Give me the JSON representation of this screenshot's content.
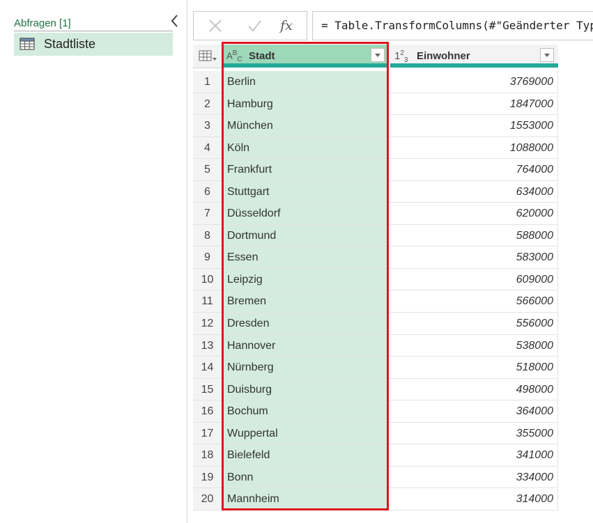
{
  "queries_pane": {
    "title": "Abfragen [1]",
    "items": [
      {
        "label": "Stadtliste",
        "icon": "table-icon"
      }
    ],
    "collapse_icon": "chevron-left-icon"
  },
  "formula_bar": {
    "cancel_icon": "x-icon",
    "commit_icon": "checkmark-icon",
    "fx_label": "fx",
    "formula": "= Table.TransformColumns(#\"Geänderter Typ"
  },
  "grid": {
    "columns": [
      {
        "name": "Stadt",
        "type_icon": "abc-type-icon",
        "type_label": "ABC"
      },
      {
        "name": "Einwohner",
        "type_icon": "123-type-icon",
        "type_label": "123"
      }
    ],
    "rows": [
      {
        "num": "1",
        "stadt": "Berlin",
        "einwohner": "3769000"
      },
      {
        "num": "2",
        "stadt": "Hamburg",
        "einwohner": "1847000"
      },
      {
        "num": "3",
        "stadt": "München",
        "einwohner": "1553000"
      },
      {
        "num": "4",
        "stadt": "Köln",
        "einwohner": "1088000"
      },
      {
        "num": "5",
        "stadt": "Frankfurt",
        "einwohner": "764000"
      },
      {
        "num": "6",
        "stadt": "Stuttgart",
        "einwohner": "634000"
      },
      {
        "num": "7",
        "stadt": "Düsseldorf",
        "einwohner": "620000"
      },
      {
        "num": "8",
        "stadt": "Dortmund",
        "einwohner": "588000"
      },
      {
        "num": "9",
        "stadt": "Essen",
        "einwohner": "583000"
      },
      {
        "num": "10",
        "stadt": "Leipzig",
        "einwohner": "609000"
      },
      {
        "num": "11",
        "stadt": "Bremen",
        "einwohner": "566000"
      },
      {
        "num": "12",
        "stadt": "Dresden",
        "einwohner": "556000"
      },
      {
        "num": "13",
        "stadt": "Hannover",
        "einwohner": "538000"
      },
      {
        "num": "14",
        "stadt": "Nürnberg",
        "einwohner": "518000"
      },
      {
        "num": "15",
        "stadt": "Duisburg",
        "einwohner": "498000"
      },
      {
        "num": "16",
        "stadt": "Bochum",
        "einwohner": "364000"
      },
      {
        "num": "17",
        "stadt": "Wuppertal",
        "einwohner": "355000"
      },
      {
        "num": "18",
        "stadt": "Bielefeld",
        "einwohner": "341000"
      },
      {
        "num": "19",
        "stadt": "Bonn",
        "einwohner": "334000"
      },
      {
        "num": "20",
        "stadt": "Mannheim",
        "einwohner": "314000"
      }
    ]
  },
  "colors": {
    "accent_green": "#217346",
    "selected_column_header": "#9dd8b9",
    "selected_column_cells": "#d3ecdf",
    "header_underline": "#21a89a",
    "highlight_border": "#e0141e"
  }
}
